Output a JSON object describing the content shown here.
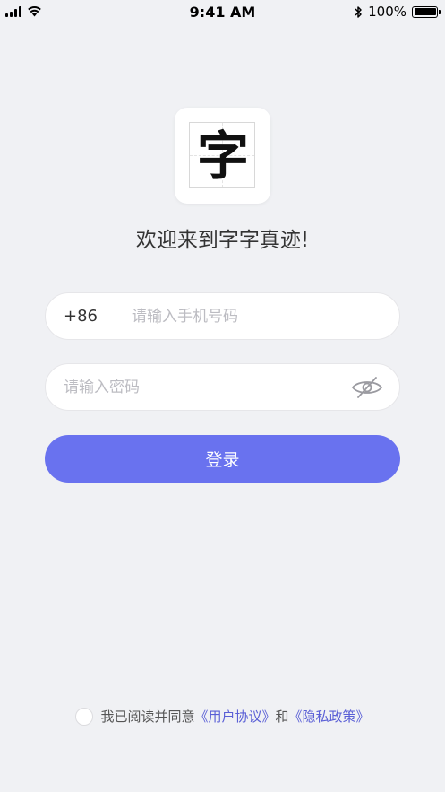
{
  "status_bar": {
    "time": "9:41 AM",
    "battery_text": "100%",
    "battery_level": 1.0,
    "icons": [
      "signal-icon",
      "wifi-icon",
      "bluetooth-icon",
      "battery-icon"
    ]
  },
  "logo": {
    "character": "字"
  },
  "welcome_text": "欢迎来到字字真迹!",
  "phone": {
    "prefix": "+86",
    "placeholder": "请输入手机号码",
    "value": ""
  },
  "password": {
    "placeholder": "请输入密码",
    "value": "",
    "toggle_icon": "eye-slash-icon"
  },
  "login_button": {
    "label": "登录",
    "color": "#6972ef"
  },
  "agreement": {
    "checked": false,
    "text_prefix": "我已阅读并同意",
    "user_agreement": "《用户协议》",
    "conjunction": "和",
    "privacy_policy": "《隐私政策》",
    "link_color": "#5a5fd6"
  },
  "colors": {
    "background": "#f0f1f4",
    "accent": "#6972ef"
  }
}
